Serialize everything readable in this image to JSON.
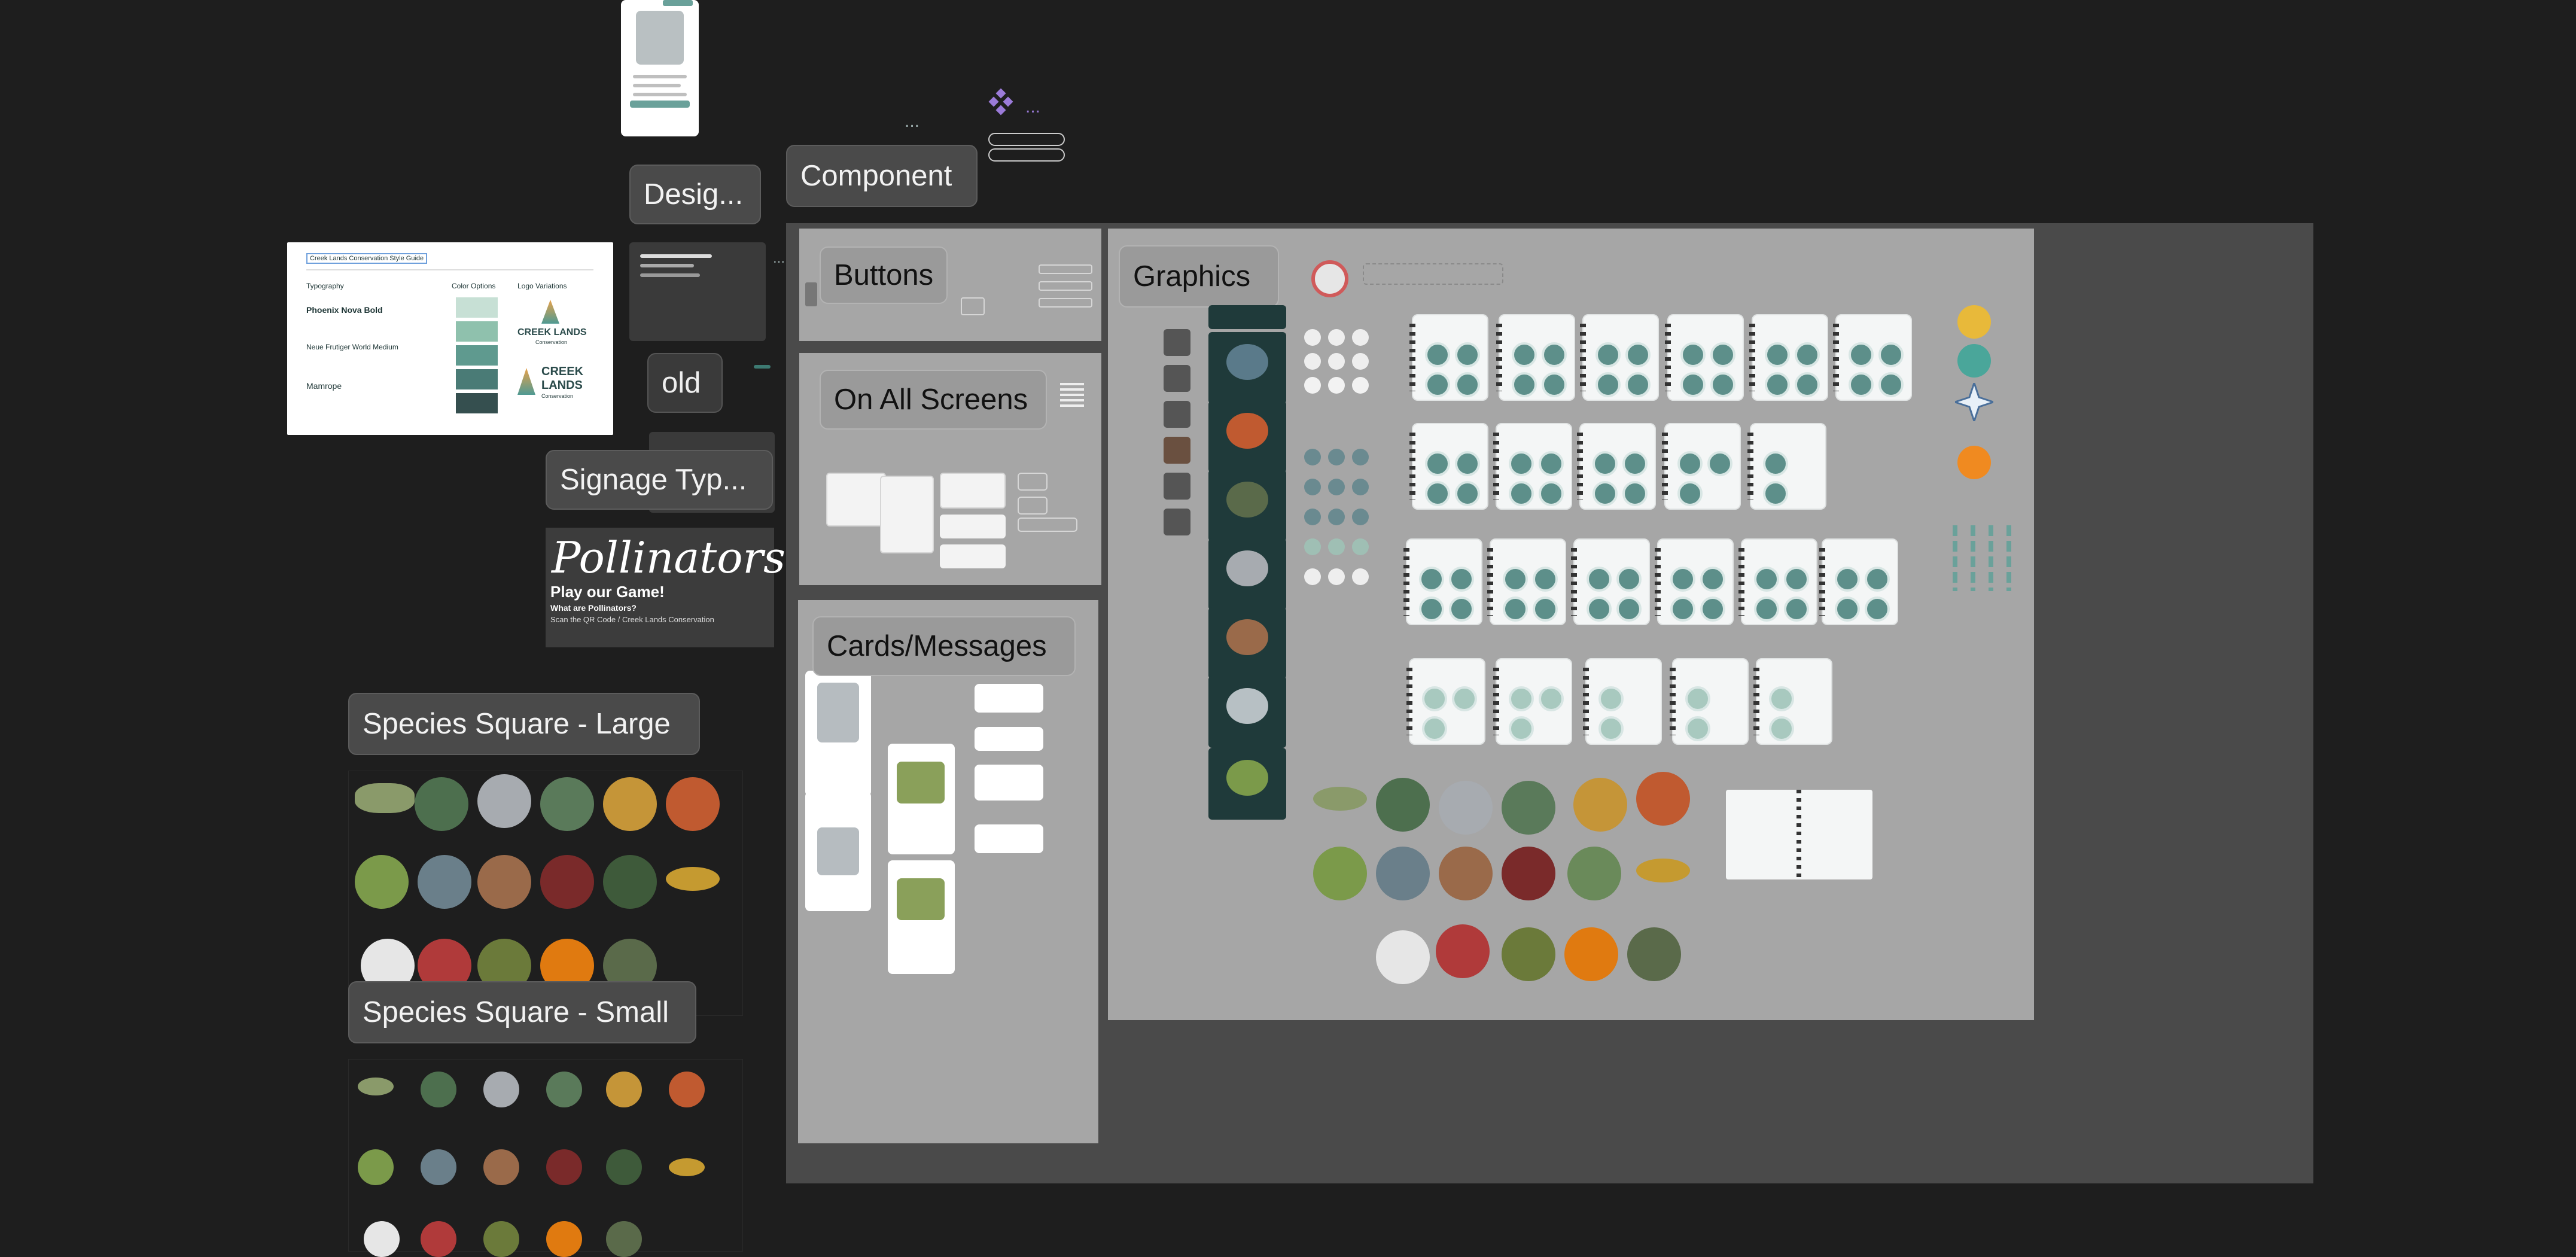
{
  "labels": {
    "desig": "Desig...",
    "component": "Component",
    "old": "old",
    "signage": "Signage Typ...",
    "buttons": "Buttons",
    "on_all_screens": "On All Screens",
    "cards_messages": "Cards/Messages",
    "graphics": "Graphics",
    "species_large": "Species Square - Large",
    "species_small": "Species Square - Small"
  },
  "style_guide": {
    "title": "Creek Lands Conservation Style Guide",
    "typography": "Typography",
    "color_options": "Color Options",
    "logo_variations": "Logo Variations",
    "font1": "Phoenix Nova Bold",
    "font2": "Neue Frutiger World Medium",
    "font3": "Mamrope",
    "logo_line1": "CREEK LANDS",
    "logo_line2": "Conservation",
    "logo2_line1": "CREEK",
    "logo2_line2": "LANDS",
    "logo2_line3": "Conservation"
  },
  "pollinators": {
    "title": "Pollinators",
    "play": "Play our Game!",
    "what": "What are Pollinators?",
    "scan": "Scan the QR Code / Creek Lands Conservation"
  },
  "icons": {
    "component_icon": "component-diamond-icon",
    "more": "..."
  },
  "colors": {
    "canvas": "#1e1e1e",
    "frame_gray": "#a6a6a6",
    "frame_dark": "#4a4a4a",
    "teal": "#5d8f8a",
    "dark_teal": "#1f3a3a"
  }
}
